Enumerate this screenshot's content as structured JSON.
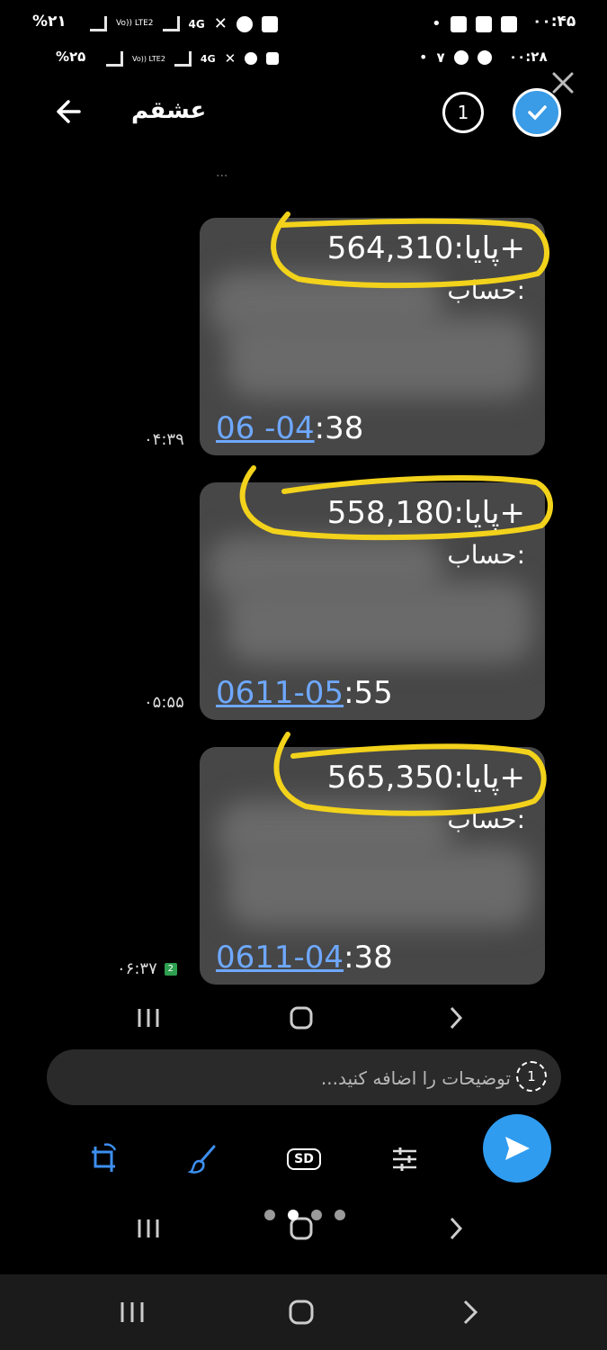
{
  "status_top": {
    "battery": "%۲۱",
    "network": "4G",
    "volte": "Vo)) LTE2",
    "time": "۰۰:۴۵",
    "icons": [
      "battery-icon",
      "signal-icon",
      "mute-icon",
      "alarm-icon",
      "notification-icon",
      "check-icon",
      "p-icon",
      "image-icon"
    ]
  },
  "status_inner": {
    "battery": "%۲۵",
    "network": "4G",
    "volte": "Vo)) LTE2",
    "time": "۰۰:۲۸",
    "extra": "۷"
  },
  "header": {
    "title": "عشقم",
    "selected_count": "1",
    "cut_text": "..."
  },
  "messages": [
    {
      "balance": "پایا:564,310+",
      "account": "حساب:",
      "stamp_link": "06  -04",
      "stamp_rest": ":38",
      "time": "۰۴:۳۹"
    },
    {
      "balance": "پایا:558,180+",
      "account": "حساب:",
      "stamp_link": "0611-05",
      "stamp_rest": ":55",
      "time": "۰۵:۵۵"
    },
    {
      "balance": "پایا:565,350+",
      "account": "حساب:",
      "stamp_link": "0611-04",
      "stamp_rest": ":38",
      "time": "۰۶:۳۷",
      "badge": "2"
    }
  ],
  "caption": {
    "placeholder": "توضیحات را اضافه کنید...",
    "timer_value": "1"
  },
  "tools": {
    "sd_label": "SD"
  },
  "colors": {
    "highlight": "#f2d21b",
    "link": "#6ea8ff",
    "send": "#2f9cf0",
    "bubble": "#474747"
  }
}
